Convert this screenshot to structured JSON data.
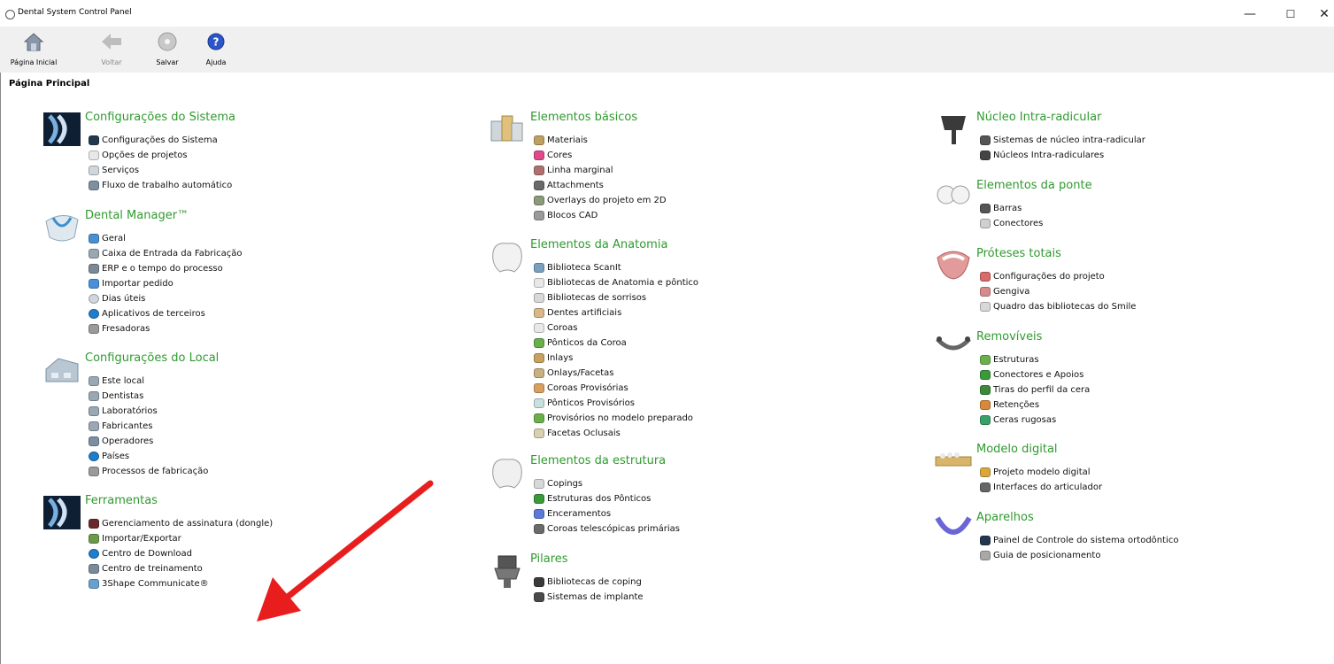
{
  "window": {
    "title": "Dental System Control Panel",
    "minimize": "—",
    "maximize": "☐",
    "close": "✕"
  },
  "toolbar": {
    "buttons": [
      {
        "label": "Página Inicial",
        "icon": "home-icon",
        "disabled": false
      },
      {
        "label": "Voltar",
        "icon": "back-arrow-icon",
        "disabled": true
      },
      {
        "label": "Salvar",
        "icon": "save-disc-icon",
        "disabled": false
      },
      {
        "label": "Ajuda",
        "icon": "help-icon",
        "disabled": false
      }
    ]
  },
  "page_title": "Página Principal",
  "colors": {
    "section_title": "#2f9a2f",
    "toolbar_bg": "#f0f0f0",
    "arrow": "#e81e1e"
  },
  "columns": [
    [
      {
        "title": "Configurações do Sistema",
        "icon": "system-settings-icon",
        "items": [
          {
            "label": "Configurações do Sistema",
            "icon": "system-small-icon"
          },
          {
            "label": "Opções de projetos",
            "icon": "tooth-small-icon"
          },
          {
            "label": "Serviços",
            "icon": "gear-icon"
          },
          {
            "label": "Fluxo de trabalho automático",
            "icon": "workflow-icon"
          }
        ]
      },
      {
        "title": "Dental Manager™",
        "icon": "dental-manager-icon",
        "items": [
          {
            "label": "Geral",
            "icon": "general-icon"
          },
          {
            "label": "Caixa de Entrada da Fabricação",
            "icon": "inbox-icon"
          },
          {
            "label": "ERP e o tempo do processo",
            "icon": "erp-icon"
          },
          {
            "label": "Importar pedido",
            "icon": "import-icon"
          },
          {
            "label": "Dias úteis",
            "icon": "clock-icon"
          },
          {
            "label": "Aplicativos de terceiros",
            "icon": "globe-icon"
          },
          {
            "label": "Fresadoras",
            "icon": "mill-icon"
          }
        ]
      },
      {
        "title": "Configurações do Local",
        "icon": "site-building-icon",
        "items": [
          {
            "label": "Este local",
            "icon": "site-icon"
          },
          {
            "label": "Dentistas",
            "icon": "site-icon"
          },
          {
            "label": "Laboratórios",
            "icon": "site-icon"
          },
          {
            "label": "Fabricantes",
            "icon": "site-icon"
          },
          {
            "label": "Operadores",
            "icon": "operators-icon"
          },
          {
            "label": "Países",
            "icon": "globe-icon"
          },
          {
            "label": "Processos de fabricação",
            "icon": "mill-icon"
          }
        ]
      },
      {
        "title": "Ferramentas",
        "icon": "tools-icon",
        "items": [
          {
            "label": "Gerenciamento de assinatura (dongle)",
            "icon": "dongle-icon"
          },
          {
            "label": "Importar/Exportar",
            "icon": "import-export-icon"
          },
          {
            "label": "Centro de Download",
            "icon": "globe-icon"
          },
          {
            "label": "Centro de treinamento",
            "icon": "training-icon"
          },
          {
            "label": "3Shape Communicate®",
            "icon": "communicate-icon"
          }
        ]
      }
    ],
    [
      {
        "title": "Elementos básicos",
        "icon": "basic-elements-icon",
        "items": [
          {
            "label": "Materiais",
            "icon": "materials-icon"
          },
          {
            "label": "Cores",
            "icon": "colors-icon"
          },
          {
            "label": "Linha marginal",
            "icon": "margin-line-icon"
          },
          {
            "label": "Attachments",
            "icon": "attachment-icon"
          },
          {
            "label": "Overlays do projeto em 2D",
            "icon": "overlay-icon"
          },
          {
            "label": "Blocos CAD",
            "icon": "cad-block-icon"
          }
        ]
      },
      {
        "title": "Elementos da Anatomia",
        "icon": "anatomy-tooth-icon",
        "items": [
          {
            "label": "Biblioteca ScanIt",
            "icon": "scanit-icon"
          },
          {
            "label": "Bibliotecas de Anatomia e pôntico",
            "icon": "tooth-small-icon"
          },
          {
            "label": "Bibliotecas de sorrisos",
            "icon": "smile-icon"
          },
          {
            "label": "Dentes artificiais",
            "icon": "artificial-teeth-icon"
          },
          {
            "label": "Coroas",
            "icon": "tooth-small-icon"
          },
          {
            "label": "Pônticos da Coroa",
            "icon": "green-tooth-icon"
          },
          {
            "label": "Inlays",
            "icon": "inlay-icon"
          },
          {
            "label": "Onlays/Facetas",
            "icon": "onlay-icon"
          },
          {
            "label": "Coroas Provisórias",
            "icon": "provisional-icon"
          },
          {
            "label": "Pônticos Provisórios",
            "icon": "provisional-pontic-icon"
          },
          {
            "label": "Provisórios no modelo preparado",
            "icon": "green-tooth-icon"
          },
          {
            "label": "Facetas Oclusais",
            "icon": "occlusal-icon"
          }
        ]
      },
      {
        "title": "Elementos da estrutura",
        "icon": "structure-tooth-icon",
        "items": [
          {
            "label": "Copings",
            "icon": "coping-icon"
          },
          {
            "label": "Estruturas dos Pônticos",
            "icon": "green-structure-icon"
          },
          {
            "label": "Enceramentos",
            "icon": "blue-wax-icon"
          },
          {
            "label": "Coroas telescópicas primárias",
            "icon": "telescopic-icon"
          }
        ]
      },
      {
        "title": "Pilares",
        "icon": "abutment-icon",
        "items": [
          {
            "label": "Bibliotecas de coping",
            "icon": "coping-library-icon"
          },
          {
            "label": "Sistemas de implante",
            "icon": "implant-icon"
          }
        ]
      }
    ],
    [
      {
        "title": "Núcleo Intra-radicular",
        "icon": "post-core-icon",
        "items": [
          {
            "label": "Sistemas de núcleo intra-radicular",
            "icon": "post-icon"
          },
          {
            "label": "Núcleos Intra-radiculares",
            "icon": "core-icon"
          }
        ]
      },
      {
        "title": "Elementos da ponte",
        "icon": "bridge-icon",
        "items": [
          {
            "label": "Barras",
            "icon": "bar-icon"
          },
          {
            "label": "Conectores",
            "icon": "connector-icon"
          }
        ]
      },
      {
        "title": "Próteses totais",
        "icon": "denture-icon",
        "items": [
          {
            "label": "Configurações do projeto",
            "icon": "project-settings-icon"
          },
          {
            "label": "Gengiva",
            "icon": "gingiva-icon"
          },
          {
            "label": "Quadro das bibliotecas do Smile",
            "icon": "smile-board-icon"
          }
        ]
      },
      {
        "title": "Removíveis",
        "icon": "removable-icon",
        "items": [
          {
            "label": "Estruturas",
            "icon": "frame-icon"
          },
          {
            "label": "Conectores e Apoios",
            "icon": "connector-support-icon"
          },
          {
            "label": "Tiras do perfil da cera",
            "icon": "wax-strip-icon"
          },
          {
            "label": "Retenções",
            "icon": "retention-icon"
          },
          {
            "label": "Ceras rugosas",
            "icon": "rugose-wax-icon"
          }
        ]
      },
      {
        "title": "Modelo digital",
        "icon": "digital-model-icon",
        "items": [
          {
            "label": "Projeto modelo digital",
            "icon": "model-project-icon"
          },
          {
            "label": "Interfaces do articulador",
            "icon": "articulator-icon"
          }
        ]
      },
      {
        "title": "Aparelhos",
        "icon": "appliance-icon",
        "items": [
          {
            "label": "Painel de Controle do sistema ortodôntico",
            "icon": "system-small-icon"
          },
          {
            "label": "Guia de posicionamento",
            "icon": "positioning-guide-icon"
          }
        ]
      }
    ]
  ]
}
